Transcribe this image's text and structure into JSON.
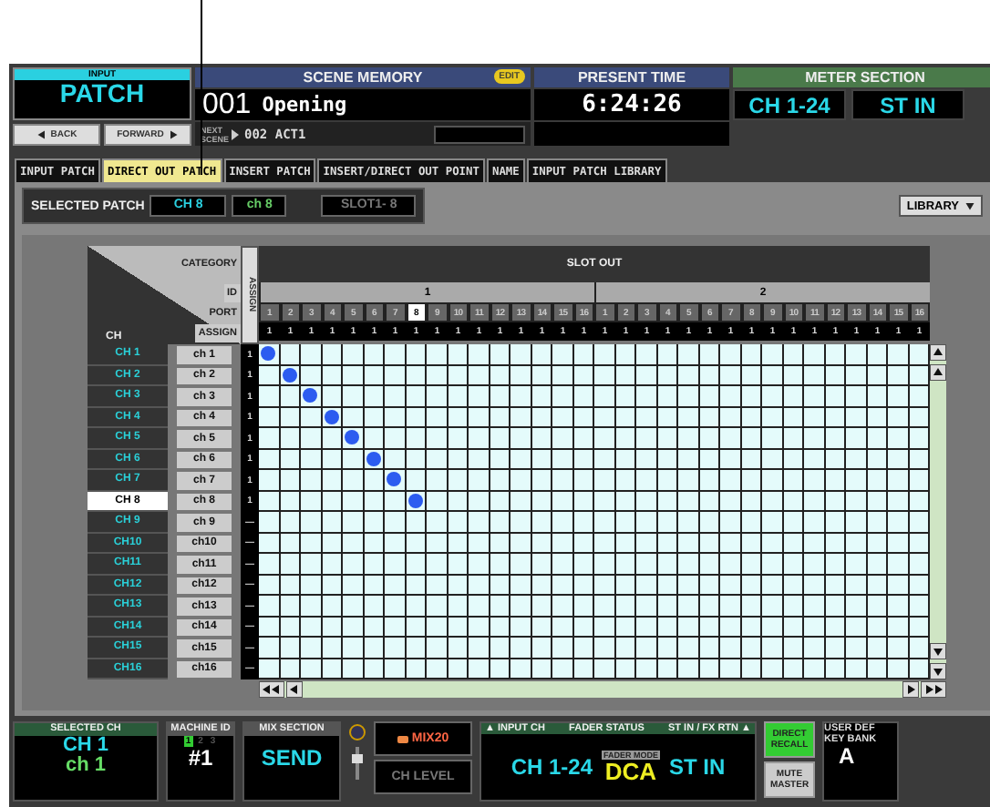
{
  "patch_block": {
    "caption": "INPUT",
    "title": "PATCH",
    "back": "BACK",
    "forward": "FORWARD"
  },
  "scene_memory": {
    "title": "SCENE MEMORY",
    "edit_badge": "EDIT",
    "number": "001",
    "name": "Opening",
    "next_label": "NEXT SCENE",
    "next_scene": "002 ACT1"
  },
  "present_time": {
    "title": "PRESENT TIME",
    "time": "6:24:26"
  },
  "meter_section": {
    "title": "METER SECTION",
    "buttons": [
      "CH 1-24",
      "ST IN"
    ]
  },
  "tabs": [
    {
      "label": "INPUT PATCH",
      "selected": false
    },
    {
      "label": "DIRECT OUT PATCH",
      "selected": true
    },
    {
      "label": "INSERT PATCH",
      "selected": false
    },
    {
      "label": "INSERT/DIRECT OUT POINT",
      "selected": false
    },
    {
      "label": "NAME",
      "selected": false
    },
    {
      "label": "INPUT PATCH LIBRARY",
      "selected": false
    }
  ],
  "selected_patch": {
    "label": "SELECTED PATCH",
    "channel": "CH 8",
    "name": "ch 8",
    "destination": "SLOT1- 8",
    "library_button": "LIBRARY"
  },
  "matrix": {
    "header_labels": {
      "category": "CATEGORY",
      "id": "ID",
      "port": "PORT",
      "assign": "ASSIGN",
      "ch": "CH",
      "assign_vertical": "ASSIGN"
    },
    "category": "SLOT OUT",
    "slots": [
      {
        "id": "1",
        "ports": [
          {
            "label": "1",
            "assign": "1",
            "selected": false
          },
          {
            "label": "2",
            "assign": "1",
            "selected": false
          },
          {
            "label": "3",
            "assign": "1",
            "selected": false
          },
          {
            "label": "4",
            "assign": "1",
            "selected": false
          },
          {
            "label": "5",
            "assign": "1",
            "selected": false
          },
          {
            "label": "6",
            "assign": "1",
            "selected": false
          },
          {
            "label": "7",
            "assign": "1",
            "selected": false
          },
          {
            "label": "8",
            "assign": "1",
            "selected": true
          },
          {
            "label": "9",
            "assign": "1",
            "selected": false
          },
          {
            "label": "10",
            "assign": "1",
            "selected": false
          },
          {
            "label": "11",
            "assign": "1",
            "selected": false
          },
          {
            "label": "12",
            "assign": "1",
            "selected": false
          },
          {
            "label": "13",
            "assign": "1",
            "selected": false
          },
          {
            "label": "14",
            "assign": "1",
            "selected": false
          },
          {
            "label": "15",
            "assign": "1",
            "selected": false
          },
          {
            "label": "16",
            "assign": "1",
            "selected": false
          }
        ]
      },
      {
        "id": "2",
        "ports": [
          {
            "label": "1",
            "assign": "1",
            "selected": false
          },
          {
            "label": "2",
            "assign": "1",
            "selected": false
          },
          {
            "label": "3",
            "assign": "1",
            "selected": false
          },
          {
            "label": "4",
            "assign": "1",
            "selected": false
          },
          {
            "label": "5",
            "assign": "1",
            "selected": false
          },
          {
            "label": "6",
            "assign": "1",
            "selected": false
          },
          {
            "label": "7",
            "assign": "1",
            "selected": false
          },
          {
            "label": "8",
            "assign": "1",
            "selected": false
          },
          {
            "label": "9",
            "assign": "1",
            "selected": false
          },
          {
            "label": "10",
            "assign": "1",
            "selected": false
          },
          {
            "label": "11",
            "assign": "1",
            "selected": false
          },
          {
            "label": "12",
            "assign": "1",
            "selected": false
          },
          {
            "label": "13",
            "assign": "1",
            "selected": false
          },
          {
            "label": "14",
            "assign": "1",
            "selected": false
          },
          {
            "label": "15",
            "assign": "1",
            "selected": false
          },
          {
            "label": "16",
            "assign": "1",
            "selected": false
          }
        ]
      }
    ],
    "rows": [
      {
        "ch": "CH 1",
        "name": "ch 1",
        "assign": "1",
        "selected": false,
        "cells": [
          true,
          false,
          false,
          false,
          false,
          false,
          false,
          false,
          false,
          false,
          false,
          false,
          false,
          false,
          false,
          false,
          false,
          false,
          false,
          false,
          false,
          false,
          false,
          false,
          false,
          false,
          false,
          false,
          false,
          false,
          false,
          false
        ]
      },
      {
        "ch": "CH 2",
        "name": "ch 2",
        "assign": "1",
        "selected": false,
        "cells": [
          false,
          true,
          false,
          false,
          false,
          false,
          false,
          false,
          false,
          false,
          false,
          false,
          false,
          false,
          false,
          false,
          false,
          false,
          false,
          false,
          false,
          false,
          false,
          false,
          false,
          false,
          false,
          false,
          false,
          false,
          false,
          false
        ]
      },
      {
        "ch": "CH 3",
        "name": "ch 3",
        "assign": "1",
        "selected": false,
        "cells": [
          false,
          false,
          true,
          false,
          false,
          false,
          false,
          false,
          false,
          false,
          false,
          false,
          false,
          false,
          false,
          false,
          false,
          false,
          false,
          false,
          false,
          false,
          false,
          false,
          false,
          false,
          false,
          false,
          false,
          false,
          false,
          false
        ]
      },
      {
        "ch": "CH 4",
        "name": "ch 4",
        "assign": "1",
        "selected": false,
        "cells": [
          false,
          false,
          false,
          true,
          false,
          false,
          false,
          false,
          false,
          false,
          false,
          false,
          false,
          false,
          false,
          false,
          false,
          false,
          false,
          false,
          false,
          false,
          false,
          false,
          false,
          false,
          false,
          false,
          false,
          false,
          false,
          false
        ]
      },
      {
        "ch": "CH 5",
        "name": "ch 5",
        "assign": "1",
        "selected": false,
        "cells": [
          false,
          false,
          false,
          false,
          true,
          false,
          false,
          false,
          false,
          false,
          false,
          false,
          false,
          false,
          false,
          false,
          false,
          false,
          false,
          false,
          false,
          false,
          false,
          false,
          false,
          false,
          false,
          false,
          false,
          false,
          false,
          false
        ]
      },
      {
        "ch": "CH 6",
        "name": "ch 6",
        "assign": "1",
        "selected": false,
        "cells": [
          false,
          false,
          false,
          false,
          false,
          true,
          false,
          false,
          false,
          false,
          false,
          false,
          false,
          false,
          false,
          false,
          false,
          false,
          false,
          false,
          false,
          false,
          false,
          false,
          false,
          false,
          false,
          false,
          false,
          false,
          false,
          false
        ]
      },
      {
        "ch": "CH 7",
        "name": "ch 7",
        "assign": "1",
        "selected": false,
        "cells": [
          false,
          false,
          false,
          false,
          false,
          false,
          true,
          false,
          false,
          false,
          false,
          false,
          false,
          false,
          false,
          false,
          false,
          false,
          false,
          false,
          false,
          false,
          false,
          false,
          false,
          false,
          false,
          false,
          false,
          false,
          false,
          false
        ]
      },
      {
        "ch": "CH 8",
        "name": "ch 8",
        "assign": "1",
        "selected": true,
        "cells": [
          false,
          false,
          false,
          false,
          false,
          false,
          false,
          true,
          false,
          false,
          false,
          false,
          false,
          false,
          false,
          false,
          false,
          false,
          false,
          false,
          false,
          false,
          false,
          false,
          false,
          false,
          false,
          false,
          false,
          false,
          false,
          false
        ]
      },
      {
        "ch": "CH 9",
        "name": "ch 9",
        "assign": "—",
        "selected": false,
        "cells": [
          false,
          false,
          false,
          false,
          false,
          false,
          false,
          false,
          false,
          false,
          false,
          false,
          false,
          false,
          false,
          false,
          false,
          false,
          false,
          false,
          false,
          false,
          false,
          false,
          false,
          false,
          false,
          false,
          false,
          false,
          false,
          false
        ]
      },
      {
        "ch": "CH10",
        "name": "ch10",
        "assign": "—",
        "selected": false,
        "cells": [
          false,
          false,
          false,
          false,
          false,
          false,
          false,
          false,
          false,
          false,
          false,
          false,
          false,
          false,
          false,
          false,
          false,
          false,
          false,
          false,
          false,
          false,
          false,
          false,
          false,
          false,
          false,
          false,
          false,
          false,
          false,
          false
        ]
      },
      {
        "ch": "CH11",
        "name": "ch11",
        "assign": "—",
        "selected": false,
        "cells": [
          false,
          false,
          false,
          false,
          false,
          false,
          false,
          false,
          false,
          false,
          false,
          false,
          false,
          false,
          false,
          false,
          false,
          false,
          false,
          false,
          false,
          false,
          false,
          false,
          false,
          false,
          false,
          false,
          false,
          false,
          false,
          false
        ]
      },
      {
        "ch": "CH12",
        "name": "ch12",
        "assign": "—",
        "selected": false,
        "cells": [
          false,
          false,
          false,
          false,
          false,
          false,
          false,
          false,
          false,
          false,
          false,
          false,
          false,
          false,
          false,
          false,
          false,
          false,
          false,
          false,
          false,
          false,
          false,
          false,
          false,
          false,
          false,
          false,
          false,
          false,
          false,
          false
        ]
      },
      {
        "ch": "CH13",
        "name": "ch13",
        "assign": "—",
        "selected": false,
        "cells": [
          false,
          false,
          false,
          false,
          false,
          false,
          false,
          false,
          false,
          false,
          false,
          false,
          false,
          false,
          false,
          false,
          false,
          false,
          false,
          false,
          false,
          false,
          false,
          false,
          false,
          false,
          false,
          false,
          false,
          false,
          false,
          false
        ]
      },
      {
        "ch": "CH14",
        "name": "ch14",
        "assign": "—",
        "selected": false,
        "cells": [
          false,
          false,
          false,
          false,
          false,
          false,
          false,
          false,
          false,
          false,
          false,
          false,
          false,
          false,
          false,
          false,
          false,
          false,
          false,
          false,
          false,
          false,
          false,
          false,
          false,
          false,
          false,
          false,
          false,
          false,
          false,
          false
        ]
      },
      {
        "ch": "CH15",
        "name": "ch15",
        "assign": "—",
        "selected": false,
        "cells": [
          false,
          false,
          false,
          false,
          false,
          false,
          false,
          false,
          false,
          false,
          false,
          false,
          false,
          false,
          false,
          false,
          false,
          false,
          false,
          false,
          false,
          false,
          false,
          false,
          false,
          false,
          false,
          false,
          false,
          false,
          false,
          false
        ]
      },
      {
        "ch": "CH16",
        "name": "ch16",
        "assign": "—",
        "selected": false,
        "cells": [
          false,
          false,
          false,
          false,
          false,
          false,
          false,
          false,
          false,
          false,
          false,
          false,
          false,
          false,
          false,
          false,
          false,
          false,
          false,
          false,
          false,
          false,
          false,
          false,
          false,
          false,
          false,
          false,
          false,
          false,
          false,
          false
        ]
      }
    ]
  },
  "bottom": {
    "selected_ch": {
      "title": "SELECTED CH",
      "channel": "CH 1",
      "name": "ch 1"
    },
    "machine_id": {
      "title": "MACHINE ID",
      "ids": [
        {
          "label": "1",
          "selected": true
        },
        {
          "label": "2",
          "selected": false
        },
        {
          "label": "3",
          "selected": false
        }
      ],
      "value": "#1"
    },
    "mix_section": {
      "title": "MIX SECTION",
      "value": "SEND"
    },
    "mix_bus": "MIX20",
    "ch_level": "CH LEVEL",
    "fader_status": {
      "input_label": "▲ INPUT CH",
      "title": "FADER STATUS",
      "st_label": "ST IN / FX RTN ▲",
      "input_value": "CH 1-24",
      "mode_label": "FADER MODE",
      "mode_value": "DCA",
      "st_value": "ST IN"
    },
    "direct_recall": "DIRECT RECALL",
    "mute_master": "MUTE MASTER",
    "user_key_bank": {
      "title_1": "USER DEF",
      "title_2": "KEY BANK",
      "value": "A"
    }
  }
}
